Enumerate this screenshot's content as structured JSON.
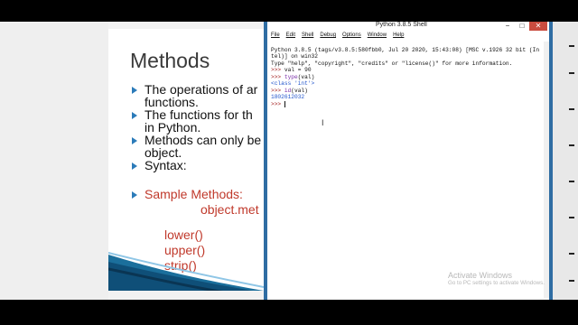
{
  "slide": {
    "title": "Methods",
    "bullets": [
      {
        "text": "The operations of ar"
      },
      {
        "text": "functions.",
        "continuation": true
      },
      {
        "text": "The functions for th"
      },
      {
        "text": "in Python.",
        "continuation": true
      },
      {
        "text": "Methods can only be"
      },
      {
        "text": "object.",
        "continuation": true
      },
      {
        "text": "Syntax:"
      }
    ],
    "syntax_example": "object.met",
    "sample_heading": "Sample Methods:",
    "methods": [
      "lower()",
      "upper()",
      "strip()"
    ]
  },
  "shell": {
    "title": "Python 3.8.5 Shell",
    "window_buttons": {
      "minimize": "−",
      "maximize": "□",
      "close": "✕"
    },
    "menu": [
      "File",
      "Edit",
      "Shell",
      "Debug",
      "Options",
      "Window",
      "Help"
    ],
    "lines": [
      {
        "kind": "plain",
        "text": "Python 3.8.5 (tags/v3.8.5:580fbb0, Jul 20 2020, 15:43:08) [MSC v.1926 32 bit (In"
      },
      {
        "kind": "plain",
        "text": "tel)] on win32"
      },
      {
        "kind": "plain",
        "text": "Type \"help\", \"copyright\", \"credits\" or \"license()\" for more information."
      },
      {
        "kind": "input",
        "prompt": ">>> ",
        "text": "val = 90"
      },
      {
        "kind": "input_builtin",
        "prompt": ">>> ",
        "builtin": "type",
        "rest": "(val)"
      },
      {
        "kind": "output",
        "text": "<class 'int'>"
      },
      {
        "kind": "input_builtin",
        "prompt": ">>> ",
        "builtin": "id",
        "rest": "(val)"
      },
      {
        "kind": "output",
        "text": "1802612032"
      },
      {
        "kind": "prompt_only",
        "prompt": ">>> "
      }
    ]
  },
  "watermark": {
    "line1": "Activate Windows",
    "line2": "Go to PC settings to activate Windows."
  },
  "colors": {
    "shell_border": "#2f6da3",
    "output_blue": "#2255cc",
    "prompt_red": "#a32020",
    "builtin_purple": "#7a2fa8",
    "slide_red": "#c0392b",
    "bullet_blue": "#2b7bb9"
  }
}
